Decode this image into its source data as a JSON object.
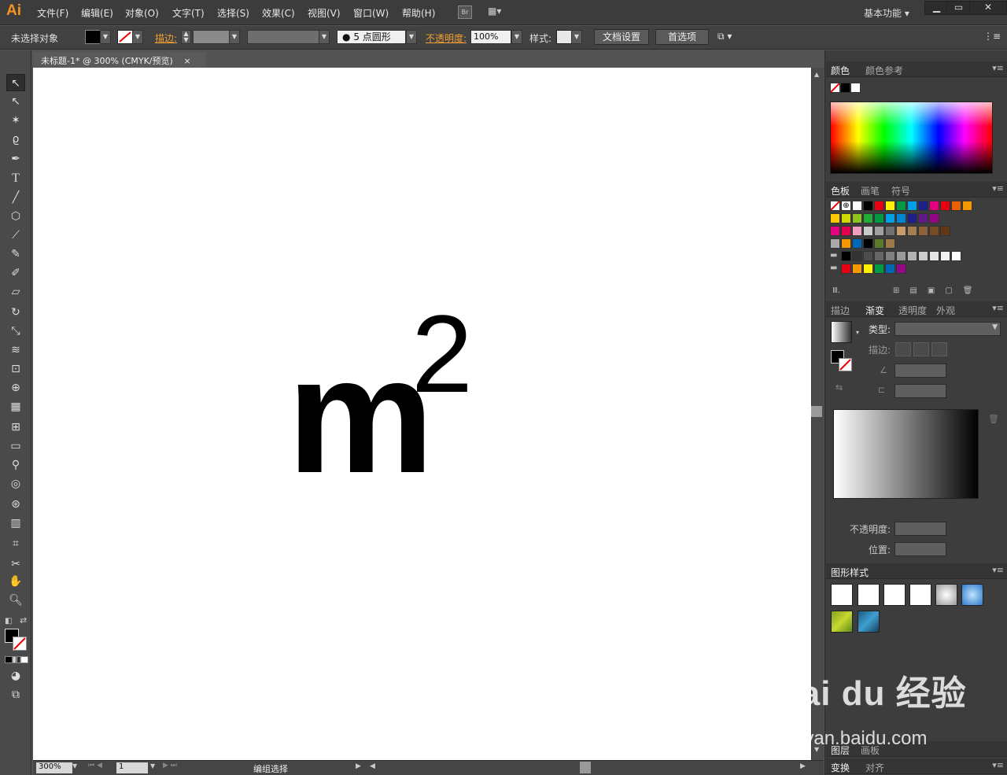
{
  "app": {
    "logo": "Ai"
  },
  "menu": [
    "文件(F)",
    "编辑(E)",
    "对象(O)",
    "文字(T)",
    "选择(S)",
    "效果(C)",
    "视图(V)",
    "窗口(W)",
    "帮助(H)"
  ],
  "br_button": "Br",
  "workspace": "基本功能",
  "window_buttons": {
    "minimize": "▁",
    "maximize": "▭",
    "close": "✕"
  },
  "control": {
    "selection": "未选择对象",
    "stroke_label": "描边:",
    "brush": "5 点圆形",
    "opacity_label": "不透明度:",
    "opacity_value": "100%",
    "style_label": "样式:",
    "doc_setup": "文档设置",
    "prefs": "首选项"
  },
  "document": {
    "tab_title": "未标题-1* @ 300% (CMYK/预览)",
    "tab_close": "×",
    "art_base": "m",
    "art_sup": "2"
  },
  "status": {
    "zoom": "300%",
    "page": "1",
    "mode": "编组选择"
  },
  "panels": {
    "color_tabs": [
      "颜色",
      "颜色参考"
    ],
    "swatch_tabs": [
      "色板",
      "画笔",
      "符号"
    ],
    "grad_tabs": [
      "描边",
      "渐变",
      "透明度",
      "外观"
    ],
    "grad_type_label": "类型:",
    "grad_stroke_label": "描边:",
    "grad_opacity_label": "不透明度:",
    "grad_position_label": "位置:",
    "graphic_styles_tab": "图形样式",
    "layers_tabs": [
      "图层",
      "画板"
    ],
    "transform_tabs": [
      "变换",
      "对齐"
    ]
  },
  "swatches": {
    "row1": [
      "#ffffff",
      "#000000",
      "#e60012",
      "#fff100",
      "#009944",
      "#00a0e9",
      "#1d2088",
      "#e4007f",
      "#e60012",
      "#eb6100",
      "#f39800"
    ],
    "row2": [
      "#fcc800",
      "#cfdb00",
      "#8fc31f",
      "#22ac38",
      "#009944",
      "#00a0e9",
      "#0086d1",
      "#1d2088",
      "#601986",
      "#920783"
    ],
    "row3": [
      "#e4007f",
      "#e5004f",
      "#f19ec2",
      "#c9caca",
      "#9fa0a0",
      "#727171",
      "#c69c6d",
      "#a67c52",
      "#8c6239",
      "#754c24",
      "#603813"
    ],
    "row4": [
      "#aaaaaa",
      "#f39800",
      "#0068b7",
      "#000000",
      "#5a7a2a",
      "#9c7a4a"
    ],
    "row5": [
      "#000000",
      "#333333",
      "#4d4d4d",
      "#666666",
      "#808080",
      "#999999",
      "#b3b3b3",
      "#cccccc",
      "#e6e6e6",
      "#f2f2f2",
      "#ffffff"
    ],
    "row6": [
      "#e60012",
      "#f39800",
      "#fff100",
      "#009944",
      "#0068b7",
      "#920783"
    ]
  },
  "watermark": {
    "text": "Bai du 经验",
    "url": "jingyan.baidu.com"
  }
}
